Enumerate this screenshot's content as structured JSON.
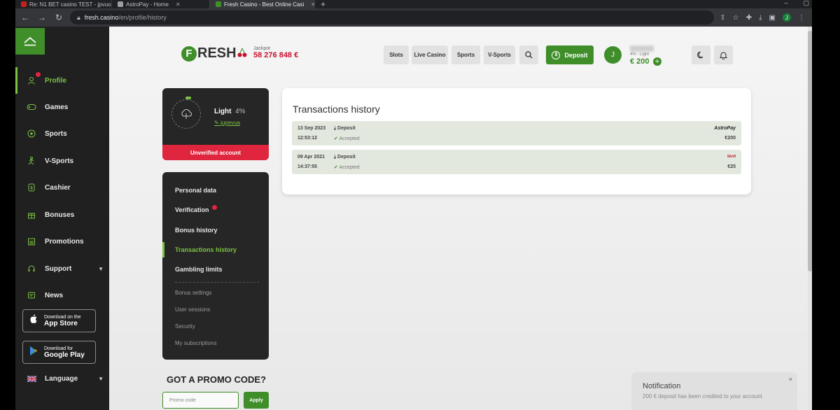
{
  "browser": {
    "tabs": [
      {
        "label": "Re: N1 BET casino TEST - jpvuori",
        "color": "#c5221f"
      },
      {
        "label": "AstroPay - Home",
        "color": "#9aa0a6"
      },
      {
        "label": "Fresh Casino - Best Online Casi",
        "color": "#3f8e2a"
      }
    ],
    "url_host": "fresh.casino",
    "url_path": "/en/profile/history",
    "profile_initial": "J"
  },
  "sidebar": {
    "items": [
      {
        "label": "Profile",
        "icon": "user-icon"
      },
      {
        "label": "Games",
        "icon": "gamepad-icon"
      },
      {
        "label": "Sports",
        "icon": "ball-icon"
      },
      {
        "label": "V-Sports",
        "icon": "runner-icon"
      },
      {
        "label": "Cashier",
        "icon": "wallet-icon"
      },
      {
        "label": "Bonuses",
        "icon": "gift-icon"
      },
      {
        "label": "Promotions",
        "icon": "calendar-icon"
      },
      {
        "label": "Support",
        "icon": "headset-icon"
      },
      {
        "label": "News",
        "icon": "news-icon"
      }
    ],
    "app_store": {
      "small": "Download on the",
      "big": "App Store"
    },
    "google_play": {
      "small": "Download for",
      "big": "Google Play"
    },
    "language": "Language"
  },
  "header": {
    "brand_initial": "F",
    "brand_rest": "RESH",
    "jackpot_label": "Jackpot",
    "jackpot_value": "58 276 848 €",
    "nav": [
      "Slots",
      "Live Casino",
      "Sports",
      "V-Sports"
    ],
    "deposit": "Deposit",
    "avatar_initial": "J",
    "user_level": "4% - Light",
    "balance": "€ 200",
    "plus": "+"
  },
  "profile": {
    "level_name": "Light",
    "level_pct": "4%",
    "username": "jupevua",
    "unverified": "Unverified account"
  },
  "menu": {
    "items": [
      "Personal data",
      "Verification",
      "Bonus history",
      "Transactions history",
      "Gambling limits"
    ],
    "sub_items": [
      "Bonus settings",
      "User sessions",
      "Security",
      "My subscriptions"
    ]
  },
  "promo": {
    "title": "GOT A PROMO CODE?",
    "placeholder": "Promo code",
    "apply": "Apply"
  },
  "transactions": {
    "title": "Transactions history",
    "rows": [
      {
        "date": "13 Sep 2023",
        "time": "12:53:12",
        "type": "Deposit",
        "status": "Accepted",
        "method": "AstroPay",
        "amount": "€200"
      },
      {
        "date": "09 Apr 2021",
        "time": "14:37:55",
        "type": "Deposit",
        "status": "Accepted",
        "method": "Skrill",
        "amount": "€25"
      }
    ]
  },
  "notification": {
    "title": "Notification",
    "message": "200 € deposit has been credited to your account",
    "close": "×"
  },
  "colors": {
    "accent": "#3f8e2a",
    "alert": "#e0263f",
    "sidebar": "#202020"
  }
}
